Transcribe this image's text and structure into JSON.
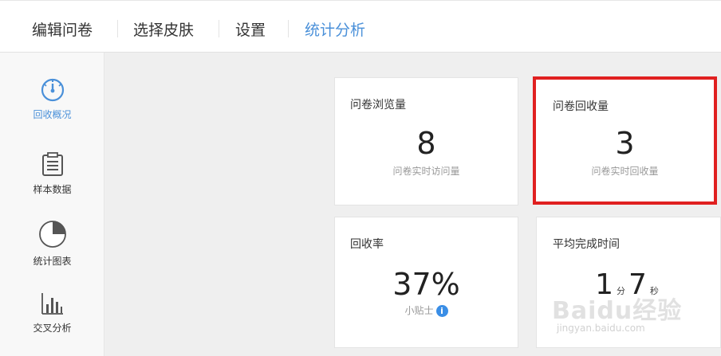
{
  "tabs": [
    {
      "label": "编辑问卷"
    },
    {
      "label": "选择皮肤"
    },
    {
      "label": "设置"
    },
    {
      "label": "统计分析"
    }
  ],
  "active_tab": "统计分析",
  "accent_color": "#4a90d9",
  "highlight_color": "#e02020",
  "sidebar": {
    "items": [
      {
        "label": "回收概况",
        "icon": "gauge-icon",
        "active": true
      },
      {
        "label": "样本数据",
        "icon": "clipboard-icon",
        "active": false
      },
      {
        "label": "统计图表",
        "icon": "pie-chart-icon",
        "active": false
      },
      {
        "label": "交叉分析",
        "icon": "bar-chart-icon",
        "active": false
      }
    ]
  },
  "cards": {
    "views": {
      "title": "问卷浏览量",
      "value": "8",
      "sub": "问卷实时访问量"
    },
    "responses": {
      "title": "问卷回收量",
      "value": "3",
      "sub": "问卷实时回收量"
    },
    "rate": {
      "title": "回收率",
      "value": "37%",
      "sub": "小贴士",
      "info_icon": "i"
    },
    "avg_time": {
      "title": "平均完成时间",
      "minutes": "1",
      "minutes_unit": "分",
      "seconds": "7",
      "seconds_unit": "秒"
    }
  },
  "watermark": {
    "main": "Baidu经验",
    "sub": "jingyan.baidu.com"
  }
}
